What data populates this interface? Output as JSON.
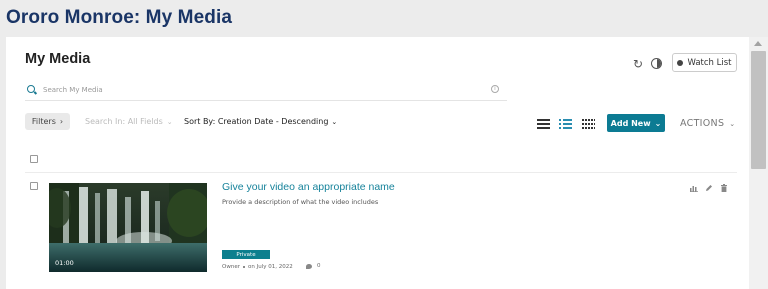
{
  "header": {
    "title": "Ororo Monroe: My Media"
  },
  "main": {
    "heading": "My Media",
    "watch_list_label": "Watch List",
    "search": {
      "placeholder": "Search My Media"
    },
    "filters_label": "Filters",
    "search_in_label": "Search In: All Fields",
    "sort_label": "Sort By: Creation Date - Descending",
    "add_new_label": "Add New",
    "actions_label": "ACTIONS"
  },
  "entries": [
    {
      "title": "Give your video an appropriate name",
      "description": "Provide a description of what the video includes",
      "duration": "01:00",
      "status": "Private",
      "owner_label": "Owner",
      "date": "on July 01, 2022",
      "comments": "0"
    }
  ],
  "colors": {
    "brand_title": "#1a3566",
    "accent": "#0c7b93",
    "link": "#17839b"
  },
  "icons": [
    "refresh-icon",
    "contrast-icon",
    "search-icon",
    "info-icon",
    "list-view-icon",
    "detailed-view-icon",
    "grid-view-icon",
    "stats-icon",
    "edit-icon",
    "delete-icon",
    "comment-icon"
  ]
}
